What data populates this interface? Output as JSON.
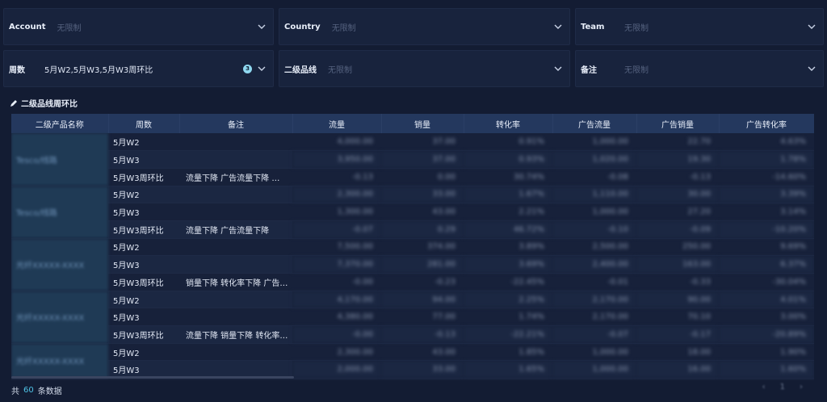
{
  "filters": {
    "row1": [
      {
        "label": "Account",
        "value": "无限制",
        "set": false
      },
      {
        "label": "Country",
        "value": "无限制",
        "set": false
      },
      {
        "label": "Team",
        "value": "无限制",
        "set": false
      }
    ],
    "row2": [
      {
        "label": "周数",
        "value": "5月W2,5月W3,5月W3周环比",
        "set": true,
        "badge": "3"
      },
      {
        "label": "二级品线",
        "value": "无限制",
        "set": false
      },
      {
        "label": "备注",
        "value": "无限制",
        "set": false
      }
    ]
  },
  "section_title": "二级品线周环比",
  "table": {
    "columns": [
      "二级产品名称",
      "周数",
      "备注",
      "流量",
      "销量",
      "转化率",
      "广告流量",
      "广告销量",
      "广告转化率"
    ],
    "groups": [
      {
        "name": "Tesco/线路",
        "rows": [
          {
            "week": "5月W2",
            "note": "",
            "v": [
              "4,000.00",
              "37.00",
              "0.91%",
              "1,000.00",
              "22.70",
              "4.63%"
            ]
          },
          {
            "week": "5月W3",
            "note": "",
            "v": [
              "3,950.00",
              "37.00",
              "0.93%",
              "1,020.00",
              "19.30",
              "1.78%"
            ]
          },
          {
            "week": "5月W3周环比",
            "note": "流量下降  广告流量下降 …",
            "v": [
              "-0.13",
              "0.00",
              "30.74%",
              "-0.08",
              "-0.13",
              "-14.60%"
            ]
          }
        ]
      },
      {
        "name": "Tesco/线路",
        "rows": [
          {
            "week": "5月W2",
            "note": "",
            "v": [
              "2,300.00",
              "33.00",
              "1.67%",
              "1,110.00",
              "30.00",
              "3.39%"
            ]
          },
          {
            "week": "5月W3",
            "note": "",
            "v": [
              "1,300.00",
              "43.00",
              "2.21%",
              "1,000.00",
              "27.20",
              "3.14%"
            ]
          },
          {
            "week": "5月W3周环比",
            "note": "流量下降   广告流量下降",
            "v": [
              "-0.07",
              "0.29",
              "46.72%",
              "-0.10",
              "-0.09",
              "-10.20%"
            ]
          }
        ]
      },
      {
        "name": "光纤XXXXX-XXXX",
        "rows": [
          {
            "week": "5月W2",
            "note": "",
            "v": [
              "7,500.00",
              "374.00",
              "3.89%",
              "2,500.00",
              "250.00",
              "9.69%"
            ]
          },
          {
            "week": "5月W3",
            "note": "",
            "v": [
              "7,370.00",
              "281.00",
              "3.69%",
              "2,400.00",
              "163.00",
              "6.37%"
            ]
          },
          {
            "week": "5月W3周环比",
            "note": "销量下降  转化率下降  广告…",
            "v": [
              "-0.00",
              "-0.23",
              "-22.45%",
              "-0.01",
              "-0.33",
              "-30.04%"
            ]
          }
        ]
      },
      {
        "name": "光纤XXXXX-XXXX",
        "rows": [
          {
            "week": "5月W2",
            "note": "",
            "v": [
              "4,170.00",
              "94.00",
              "2.25%",
              "2,170.00",
              "90.00",
              "4.01%"
            ]
          },
          {
            "week": "5月W3",
            "note": "",
            "v": [
              "4,380.00",
              "77.00",
              "1.74%",
              "2,170.00",
              "70.10",
              "3.00%"
            ]
          },
          {
            "week": "5月W3周环比",
            "note": "流量下降  销量下降  转化率…",
            "v": [
              "-0.00",
              "-0.13",
              "-22.21%",
              "-0.07",
              "-0.17",
              "-20.89%"
            ]
          }
        ]
      },
      {
        "name": "光纤XXXXX-XXXX",
        "rows": [
          {
            "week": "5月W2",
            "note": "",
            "v": [
              "2,300.00",
              "43.00",
              "1.85%",
              "1,000.00",
              "18.00",
              "1.90%"
            ]
          },
          {
            "week": "5月W3",
            "note": "",
            "v": [
              "2,000.00",
              "33.00",
              "1.65%",
              "1,000.00",
              "16.00",
              "1.60%"
            ]
          }
        ]
      }
    ]
  },
  "footer": {
    "prefix": "共",
    "count": "60",
    "suffix": "条数据"
  },
  "pager": [
    "‹",
    "1",
    "›"
  ],
  "colors": {
    "background": "#131c33",
    "header": "#24385e",
    "accent": "#4fc3e6"
  }
}
